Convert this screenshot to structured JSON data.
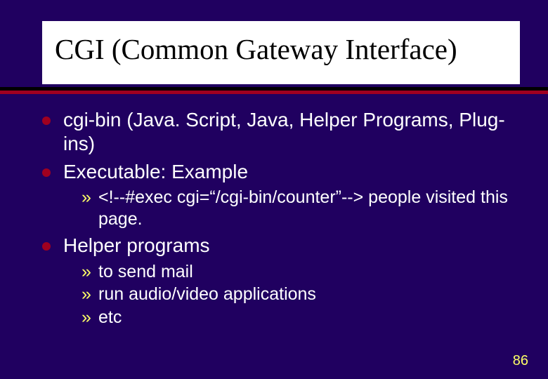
{
  "title": "CGI (Common Gateway Interface)",
  "bullets": {
    "b1": "cgi-bin (Java. Script, Java, Helper Programs, Plug-ins)",
    "b2": "Executable: Example",
    "b2s1": "<!--#exec cgi=“/cgi-bin/counter”--> people visited this page.",
    "b3": "Helper programs",
    "b3s1": "to send mail",
    "b3s2": "run audio/video applications",
    "b3s3": "etc"
  },
  "page_number": "86"
}
